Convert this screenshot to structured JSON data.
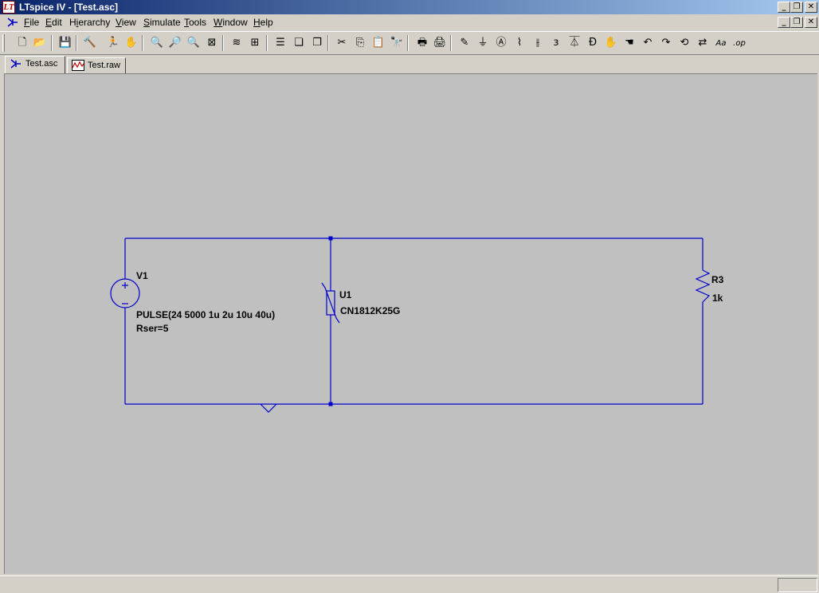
{
  "window": {
    "title": "LTspice IV - [Test.asc]",
    "app_icon": "ltspice-logo-icon",
    "app_icon_text": "LT"
  },
  "window_controls": {
    "minimize": "_",
    "restore": "❐",
    "close": "✕"
  },
  "menu": {
    "doc_icon": "schematic-icon",
    "items": [
      {
        "label": "File",
        "accel": "F",
        "rest": "ile"
      },
      {
        "label": "Edit",
        "accel": "E",
        "rest": "dit"
      },
      {
        "label": "Hierarchy",
        "pre": "H",
        "accel": "i",
        "rest": "erarchy"
      },
      {
        "label": "View",
        "accel": "V",
        "rest": "iew"
      },
      {
        "label": "Simulate",
        "accel": "S",
        "rest": "imulate"
      },
      {
        "label": "Tools",
        "accel": "T",
        "rest": "ools"
      },
      {
        "label": "Window",
        "accel": "W",
        "rest": "indow"
      },
      {
        "label": "Help",
        "accel": "H",
        "rest": "elp"
      }
    ]
  },
  "toolbar": {
    "buttons": [
      {
        "name": "new-schematic-icon",
        "glyph": "🗋"
      },
      {
        "name": "open-icon",
        "glyph": "📂"
      },
      {
        "name": "save-icon",
        "glyph": "💾"
      },
      {
        "name": "control-panel-icon",
        "glyph": "🔨"
      },
      {
        "name": "run-icon",
        "glyph": "🏃"
      },
      {
        "name": "halt-icon",
        "glyph": "✋"
      },
      {
        "name": "zoom-in-icon",
        "glyph": "🔍"
      },
      {
        "name": "pan-icon",
        "glyph": "🔎"
      },
      {
        "name": "zoom-out-icon",
        "glyph": "🔍"
      },
      {
        "name": "zoom-fit-icon",
        "glyph": "⊠"
      },
      {
        "name": "autorange-icon",
        "glyph": "≋"
      },
      {
        "name": "grid-icon",
        "glyph": "⊞"
      },
      {
        "name": "tile-horizontal-icon",
        "glyph": "☰"
      },
      {
        "name": "cascade-icon",
        "glyph": "❏"
      },
      {
        "name": "tile-vertical-icon",
        "glyph": "❐"
      },
      {
        "name": "cut-icon",
        "glyph": "✂"
      },
      {
        "name": "copy-icon",
        "glyph": "⎘"
      },
      {
        "name": "paste-icon",
        "glyph": "📋"
      },
      {
        "name": "find-icon",
        "glyph": "🔭"
      },
      {
        "name": "print-preview-icon",
        "glyph": "🖶"
      },
      {
        "name": "print-icon",
        "glyph": "🖨"
      },
      {
        "name": "draw-wire-icon",
        "glyph": "✎"
      },
      {
        "name": "ground-icon",
        "glyph": "⏚"
      },
      {
        "name": "label-net-icon",
        "glyph": "Ⓐ"
      },
      {
        "name": "resistor-icon",
        "glyph": "⌇"
      },
      {
        "name": "capacitor-icon",
        "glyph": "⫲"
      },
      {
        "name": "inductor-icon",
        "glyph": "ɜ"
      },
      {
        "name": "diode-icon",
        "glyph": "⏄"
      },
      {
        "name": "component-icon",
        "glyph": "Ð"
      },
      {
        "name": "move-icon",
        "glyph": "✋"
      },
      {
        "name": "drag-icon",
        "glyph": "☚"
      },
      {
        "name": "undo-icon",
        "glyph": "↶"
      },
      {
        "name": "redo-icon",
        "glyph": "↷"
      },
      {
        "name": "rotate-icon",
        "glyph": "⟲"
      },
      {
        "name": "mirror-icon",
        "glyph": "⇄"
      },
      {
        "name": "text-icon",
        "glyph": "Aa"
      },
      {
        "name": "spice-directive-icon",
        "glyph": ".op"
      }
    ]
  },
  "tabs": [
    {
      "label": "Test.asc",
      "icon": "schematic-icon",
      "active": true
    },
    {
      "label": "Test.raw",
      "icon": "waveform-icon",
      "active": false
    }
  ],
  "schematic": {
    "wire_color": "#0000cc",
    "components": {
      "v1": {
        "ref": "V1",
        "value": "PULSE(24 5000 1u 2u 10u 40u)",
        "extra": "Rser=5"
      },
      "u1": {
        "ref": "U1",
        "value": "CN1812K25G"
      },
      "r3": {
        "ref": "R3",
        "value": "1k"
      }
    }
  }
}
